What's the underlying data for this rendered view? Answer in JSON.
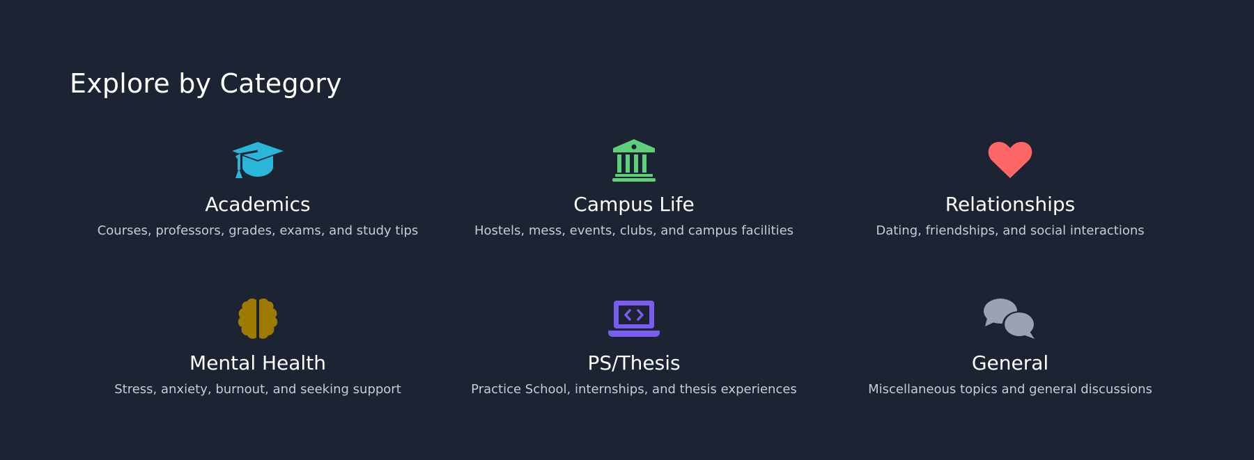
{
  "section": {
    "title": "Explore by Category"
  },
  "categories": [
    {
      "title": "Academics",
      "description": "Courses, professors, grades, exams, and study tips",
      "icon": "graduation-cap-icon",
      "color": "#29b6d9"
    },
    {
      "title": "Campus Life",
      "description": "Hostels, mess, events, clubs, and campus facilities",
      "icon": "building-columns-icon",
      "color": "#5fd07a"
    },
    {
      "title": "Relationships",
      "description": "Dating, friendships, and social interactions",
      "icon": "heart-icon",
      "color": "#ff6666"
    },
    {
      "title": "Mental Health",
      "description": "Stress, anxiety, burnout, and seeking support",
      "icon": "brain-icon",
      "color": "#9c7b00"
    },
    {
      "title": "PS/Thesis",
      "description": "Practice School, internships, and thesis experiences",
      "icon": "laptop-code-icon",
      "color": "#7b5cf0"
    },
    {
      "title": "General",
      "description": "Miscellaneous topics and general discussions",
      "icon": "comments-icon",
      "color": "#9aa3b5"
    }
  ]
}
